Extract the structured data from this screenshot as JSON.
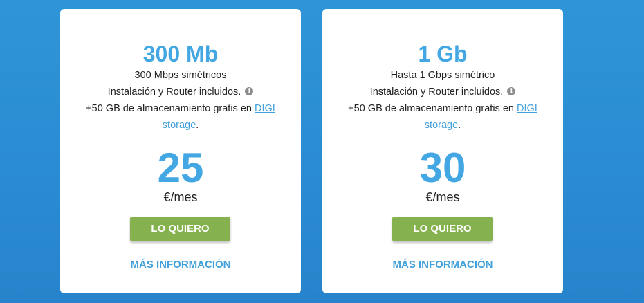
{
  "plans": [
    {
      "title": "300 Mb",
      "feature1": "300 Mbps simétricos",
      "feature2": "Instalación y Router incluidos.",
      "feature3_prefix": "+50 GB de almacenamiento gratis en ",
      "feature3_link1": "DIGI",
      "feature3_link2": "storage",
      "feature3_suffix": ".",
      "price": "25",
      "price_unit": "€/mes",
      "cta_label": "LO QUIERO",
      "more_label": "MÁS INFORMACIÓN"
    },
    {
      "title": "1 Gb",
      "feature1": "Hasta 1 Gbps simétrico",
      "feature2": "Instalación y Router incluidos.",
      "feature3_prefix": "+50 GB de almacenamiento gratis en ",
      "feature3_link1": "DIGI",
      "feature3_link2": "storage",
      "feature3_suffix": ".",
      "price": "30",
      "price_unit": "€/mes",
      "cta_label": "LO QUIERO",
      "more_label": "MÁS INFORMACIÓN"
    }
  ],
  "info_icon_glyph": "i",
  "colors": {
    "background": "#2f95d8",
    "accent_blue": "#42a7e2",
    "cta_green": "#85b14e",
    "link_blue": "#42a0dc"
  }
}
